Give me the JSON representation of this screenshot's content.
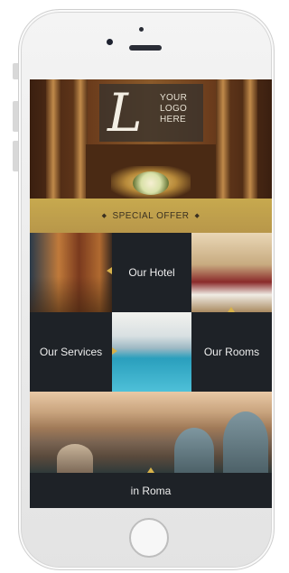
{
  "app": {
    "logo": {
      "mark": "L",
      "text": "YOUR LOGO HERE"
    },
    "banner": {
      "label": "SPECIAL OFFER"
    },
    "tiles": {
      "hotel": "Our Hotel",
      "services": "Our Services",
      "rooms": "Our Rooms",
      "city": "in Roma"
    }
  },
  "colors": {
    "accent_gold": "#c7a94e",
    "tile_dark": "#1e2227",
    "phone_body": "#eaeaea"
  },
  "icons": [
    "camera-icon",
    "speaker-icon",
    "home-button-icon",
    "arrow-left-icon",
    "arrow-up-icon",
    "arrow-right-icon"
  ]
}
